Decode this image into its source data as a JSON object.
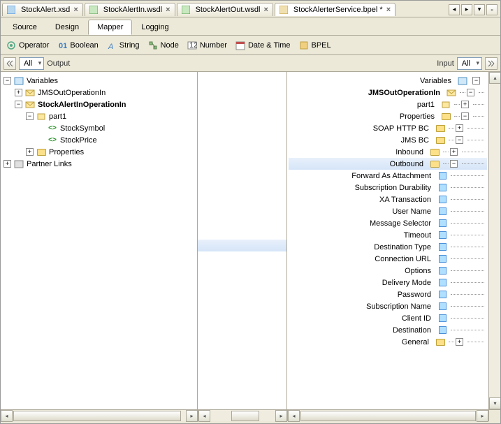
{
  "tabs": [
    {
      "label": "StockAlert.xsd"
    },
    {
      "label": "StockAlertIn.wsdl"
    },
    {
      "label": "StockAlertOut.wsdl"
    },
    {
      "label": "StockAlerterService.bpel *"
    }
  ],
  "subtabs": {
    "source": "Source",
    "design": "Design",
    "mapper": "Mapper",
    "logging": "Logging"
  },
  "toolbar": {
    "operator": "Operator",
    "boolean": "Boolean",
    "string": "String",
    "node": "Node",
    "number": "Number",
    "datetime": "Date & Time",
    "bpel": "BPEL"
  },
  "filters": {
    "all_left": "All",
    "output": "Output",
    "input": "Input",
    "all_right": "All"
  },
  "left_tree": {
    "variables": "Variables",
    "jms_out": "JMSOutOperationIn",
    "stockalert_in": "StockAlertInOperationIn",
    "part1": "part1",
    "stock_symbol": "StockSymbol",
    "stock_price": "StockPrice",
    "properties": "Properties",
    "partner_links": "Partner Links"
  },
  "right_tree": {
    "variables": "Variables",
    "jms_out": "JMSOutOperationIn",
    "part1": "part1",
    "properties": "Properties",
    "soap_http_bc": "SOAP HTTP BC",
    "jms_bc": "JMS BC",
    "inbound": "Inbound",
    "outbound": "Outbound",
    "forward_attachment": "Forward As Attachment",
    "sub_durability": "Subscription Durability",
    "xa_transaction": "XA Transaction",
    "user_name": "User Name",
    "msg_selector": "Message Selector",
    "timeout": "Timeout",
    "dest_type": "Destination Type",
    "conn_url": "Connection URL",
    "options": "Options",
    "delivery_mode": "Delivery Mode",
    "password": "Password",
    "sub_name": "Subscription Name",
    "client_id": "Client ID",
    "destination": "Destination",
    "general": "General"
  }
}
